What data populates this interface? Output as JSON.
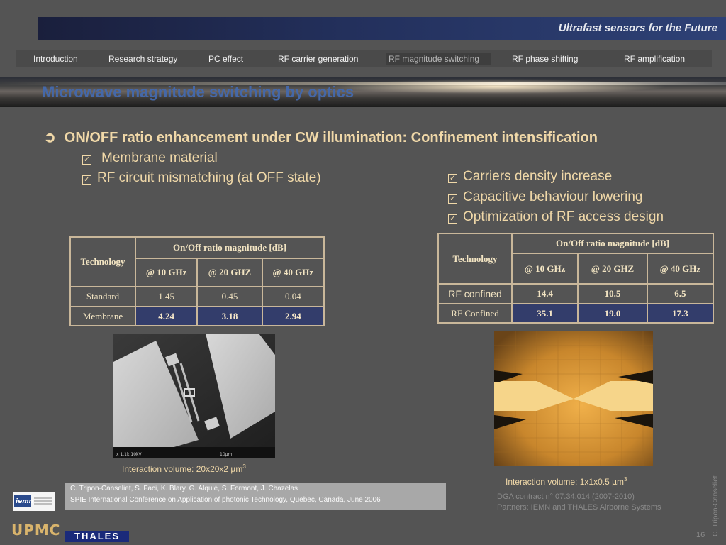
{
  "header": {
    "title": "Ultrafast sensors for the Future"
  },
  "nav": {
    "items": [
      {
        "label": "Introduction"
      },
      {
        "label": "Research strategy"
      },
      {
        "label": "PC effect"
      },
      {
        "label": "RF carrier generation"
      },
      {
        "label": "RF  magnitude switching",
        "active": true
      },
      {
        "label": "RF  phase shifting"
      },
      {
        "label": "RF  amplification"
      }
    ]
  },
  "slide": {
    "title": "Microwave magnitude switching by optics",
    "main_bullet": "ON/OFF ratio enhancement under CW illumination: Confinement intensification",
    "left_points": [
      "Membrane material",
      "RF  circuit mismatching (at OFF state)"
    ],
    "right_points": [
      "Carriers density increase",
      "Capacitive behaviour lowering",
      "Optimization of  RF access design"
    ]
  },
  "table_left": {
    "technology_header": "Technology",
    "group_header": "On/Off ratio magnitude [dB]",
    "columns": [
      "@ 10 GHz",
      "@ 20 GHZ",
      "@ 40 GHz"
    ],
    "rows": [
      {
        "name": "Standard",
        "values": [
          "1.45",
          "0.45",
          "0.04"
        ]
      },
      {
        "name": "Membrane",
        "values": [
          "4.24",
          "3.18",
          "2.94"
        ]
      }
    ]
  },
  "table_right": {
    "technology_header": "Technology",
    "group_header": "On/Off ratio magnitude [dB]",
    "columns": [
      "@ 10 GHz",
      "@ 20 GHZ",
      "@ 40 GHz"
    ],
    "rows": [
      {
        "name": "RF confined",
        "values": [
          "14.4",
          "10.5",
          "6.5"
        ]
      },
      {
        "name": "RF Confined",
        "values": [
          "35.1",
          "19.0",
          "17.3"
        ]
      }
    ]
  },
  "captions": {
    "left": "Interaction volume: 20x20x2 µm",
    "left_sup": "3",
    "right": "Interaction volume: 1x1x0.5 µm",
    "right_sup": "3"
  },
  "reference": {
    "authors": "C. Tripon-Canseliet, S. Faci, K. Blary, G. Alquié, S. Formont, J. Chazelas",
    "venue": "SPIE International Conference on Application of photonic Technology, Quebec, Canada, June 2006"
  },
  "contract": {
    "line1": "DGA contract n° 07.34.014 (2007-2010)",
    "line2": "Partners: IEMN and THALES Airborne Systems"
  },
  "footer": {
    "author_vertical": "C. Tripon-Canseliet",
    "page_number": "16",
    "logo_upmc": "UPMC",
    "logo_thales": "THALES",
    "logo_iemn": "iemn"
  },
  "colors": {
    "accent_title": "#4568a8",
    "bullet_text": "#f0d8a8",
    "highlight_cell": "#333d6b",
    "background": "#545454"
  }
}
